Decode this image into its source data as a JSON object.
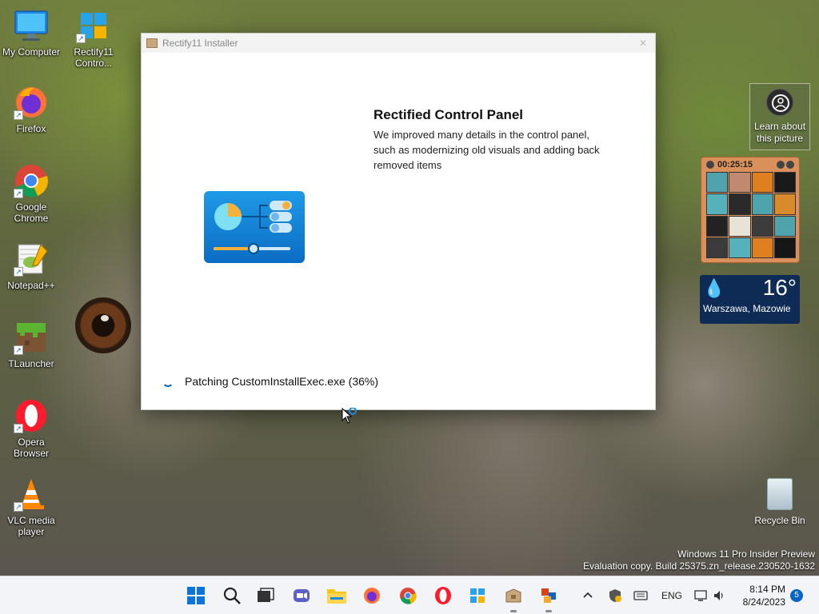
{
  "desktop": {
    "icons": [
      {
        "label": "My Computer"
      },
      {
        "label": "Rectify11 Contro..."
      },
      {
        "label": "Firefox"
      },
      {
        "label": "Google Chrome"
      },
      {
        "label": "Notepad++"
      },
      {
        "label": "TLauncher"
      },
      {
        "label": "Opera Browser"
      },
      {
        "label": "VLC media player"
      }
    ],
    "recycle_bin": "Recycle Bin",
    "watermark_line1": "Windows 11 Pro Insider Preview",
    "watermark_line2": "Evaluation copy. Build 25375.zn_release.230520-1632"
  },
  "installer": {
    "title": "Rectify11 Installer",
    "close_glyph": "✕",
    "feature_title": "Rectified Control Panel",
    "feature_description": "We improved many details in the control panel, such as modernizing old visuals and adding back removed items",
    "progress_text": "Patching CustomInstallExec.exe (36%)",
    "progress_percent": 36
  },
  "widgets": {
    "learn_picture": "Learn about this picture",
    "puzzle_timer": "00:25:15",
    "weather_temp": "16°",
    "weather_location": "Warszawa, Mazowie"
  },
  "taskbar": {
    "language": "ENG",
    "time": "8:14 PM",
    "date": "8/24/2023",
    "notification_count": "5"
  },
  "colors": {
    "accent": "#0a64c8",
    "weather_bg": "#0e2b55",
    "puzzle_bg": "#d9905a"
  }
}
